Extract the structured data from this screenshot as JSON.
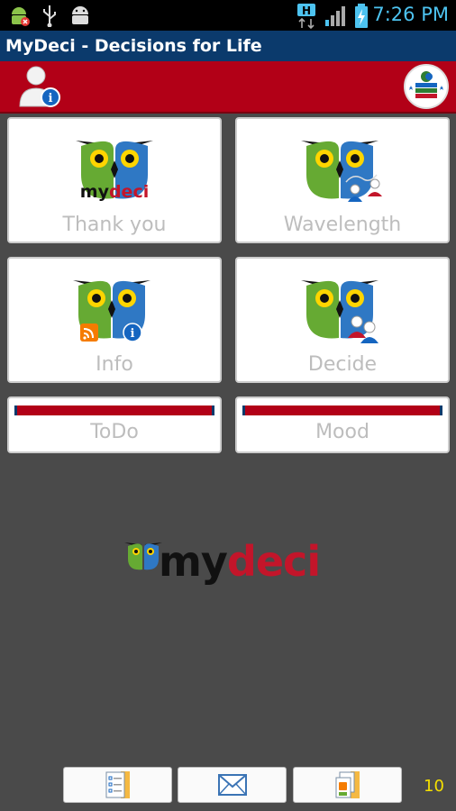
{
  "status_bar": {
    "time": "7:26 PM",
    "network": "H"
  },
  "app_title": "MyDeci - Decisions for Life",
  "tiles": [
    {
      "label": "Thank you",
      "logo_text_my": "my",
      "logo_text_deci": "deci"
    },
    {
      "label": "Wavelength"
    },
    {
      "label": "Info"
    },
    {
      "label": "Decide"
    },
    {
      "label": "ToDo"
    },
    {
      "label": "Mood"
    }
  ],
  "center_logo": {
    "my": "my",
    "deci": "deci"
  },
  "bottom": {
    "page_count": "10"
  },
  "colors": {
    "title_bar": "#0b3a6c",
    "red_bar": "#b20017",
    "background": "#4a4a4a",
    "accent_time": "#4dc3f0",
    "count_yellow": "#f5e000"
  }
}
